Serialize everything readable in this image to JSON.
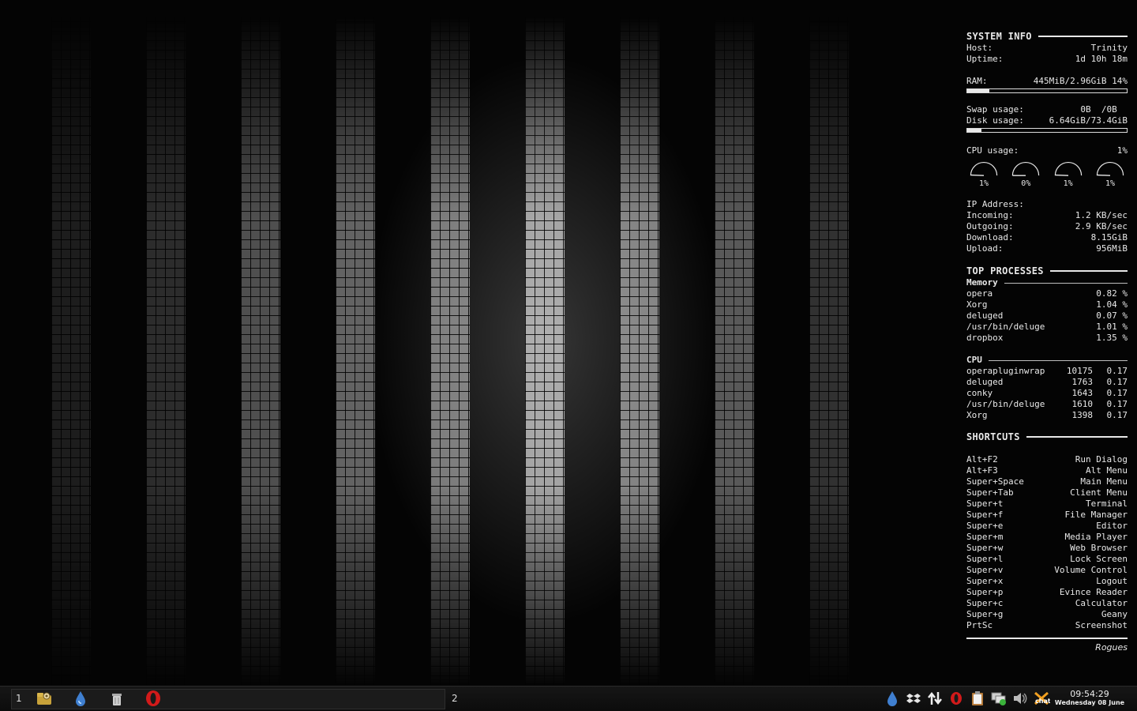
{
  "system_info": {
    "title": "SYSTEM INFO",
    "host_label": "Host:",
    "host_value": "Trinity",
    "uptime_label": "Uptime:",
    "uptime_value": "1d 10h 18m",
    "ram_label": "RAM:",
    "ram_value": "445MiB/2.96GiB 14%",
    "ram_fraction": 0.14,
    "swap_label": "Swap usage:",
    "swap_value": "0B  /0B  ",
    "disk_label": "Disk usage:",
    "disk_value": "6.64GiB/73.4GiB",
    "disk_fraction": 0.09,
    "cpu_label": "CPU usage:",
    "cpu_value": "1%",
    "cpu_cores": [
      {
        "label": "1%",
        "fraction": 0.01
      },
      {
        "label": "0%",
        "fraction": 0.0
      },
      {
        "label": "1%",
        "fraction": 0.01
      },
      {
        "label": "1%",
        "fraction": 0.01
      }
    ],
    "ip_label": "IP Address:",
    "incoming_label": "Incoming:",
    "incoming_value": "1.2 KB/sec",
    "outgoing_label": "Outgoing:",
    "outgoing_value": "2.9 KB/sec",
    "download_label": "Download:",
    "download_value": "8.15GiB",
    "upload_label": "Upload:",
    "upload_value": "956MiB"
  },
  "top_processes": {
    "title": "TOP PROCESSES",
    "memory_title": "Memory",
    "memory": [
      {
        "name": "opera",
        "value": "0.82 %"
      },
      {
        "name": "Xorg",
        "value": "1.04 %"
      },
      {
        "name": "deluged",
        "value": "0.07 %"
      },
      {
        "name": "/usr/bin/deluge",
        "value": "1.01 %"
      },
      {
        "name": "dropbox",
        "value": "1.35 %"
      }
    ],
    "cpu_title": "CPU",
    "cpu": [
      {
        "name": "operapluginwrap",
        "pid": "10175",
        "value": "0.17"
      },
      {
        "name": "deluged",
        "pid": "1763",
        "value": "0.17"
      },
      {
        "name": "conky",
        "pid": "1643",
        "value": "0.17"
      },
      {
        "name": "/usr/bin/deluge",
        "pid": "1610",
        "value": "0.17"
      },
      {
        "name": "Xorg",
        "pid": "1398",
        "value": "0.17"
      }
    ]
  },
  "shortcuts": {
    "title": "SHORTCUTS",
    "items": [
      {
        "key": "Alt+F2",
        "action": "Run Dialog"
      },
      {
        "key": "Alt+F3",
        "action": "Alt Menu"
      },
      {
        "key": "Super+Space",
        "action": "Main Menu"
      },
      {
        "key": "Super+Tab",
        "action": "Client Menu"
      },
      {
        "key": "Super+t",
        "action": "Terminal"
      },
      {
        "key": "Super+f",
        "action": "File Manager"
      },
      {
        "key": "Super+e",
        "action": "Editor"
      },
      {
        "key": "Super+m",
        "action": "Media Player"
      },
      {
        "key": "Super+w",
        "action": "Web Browser"
      },
      {
        "key": "Super+l",
        "action": "Lock Screen"
      },
      {
        "key": "Super+v",
        "action": "Volume Control"
      },
      {
        "key": "Super+x",
        "action": "Logout"
      },
      {
        "key": "Super+p",
        "action": "Evince Reader"
      },
      {
        "key": "Super+c",
        "action": "Calculator"
      },
      {
        "key": "Super+g",
        "action": "Geany"
      },
      {
        "key": "PrtSc",
        "action": "Screenshot"
      }
    ],
    "signature": "Rogues"
  },
  "taskbar": {
    "desktop_1": "1",
    "desktop_2": "2",
    "launchers": [
      "home-folder-icon",
      "deluge-icon",
      "trash-icon",
      "opera-icon"
    ],
    "tray": [
      "deluge-tray-icon",
      "dropbox-tray-icon",
      "network-transfer-icon",
      "opera-tray-icon",
      "clipboard-icon",
      "network-icon",
      "volume-icon",
      "pidgin-chat-icon"
    ],
    "clock_time": "09:54:29",
    "clock_date": "Wednesday 08 June"
  }
}
